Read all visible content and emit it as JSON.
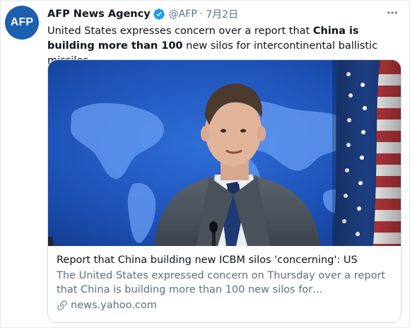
{
  "account": {
    "avatar_text": "AFP",
    "avatar_color": "#1d5fb0",
    "display_name": "AFP News Agency",
    "handle": "@AFP",
    "separator": "·",
    "date": "7月2日",
    "verified": true
  },
  "tweet": {
    "text_before": "United States expresses concern over a report that ",
    "text_bold": "China is building more than 100",
    "text_after": " new silos for intercontinental ballistic missiles"
  },
  "card": {
    "image_alt": "Man in suit and tie speaking at a podium in front of a blue world map backdrop and an American flag",
    "title": "Report that China building new ICBM silos 'concerning': US",
    "description": "The United States expressed concern on Thursday over a report that China is building more than 100 new silos for intercontinental ballistic …",
    "domain": "news.yahoo.com"
  },
  "icons": {
    "verified": "verified-badge-icon",
    "more": "more-options-icon",
    "link": "link-icon"
  },
  "colors": {
    "text_primary": "#0f1419",
    "text_secondary": "#5b7083",
    "verified_blue": "#1d9bf0",
    "card_border": "#cfd9de"
  }
}
